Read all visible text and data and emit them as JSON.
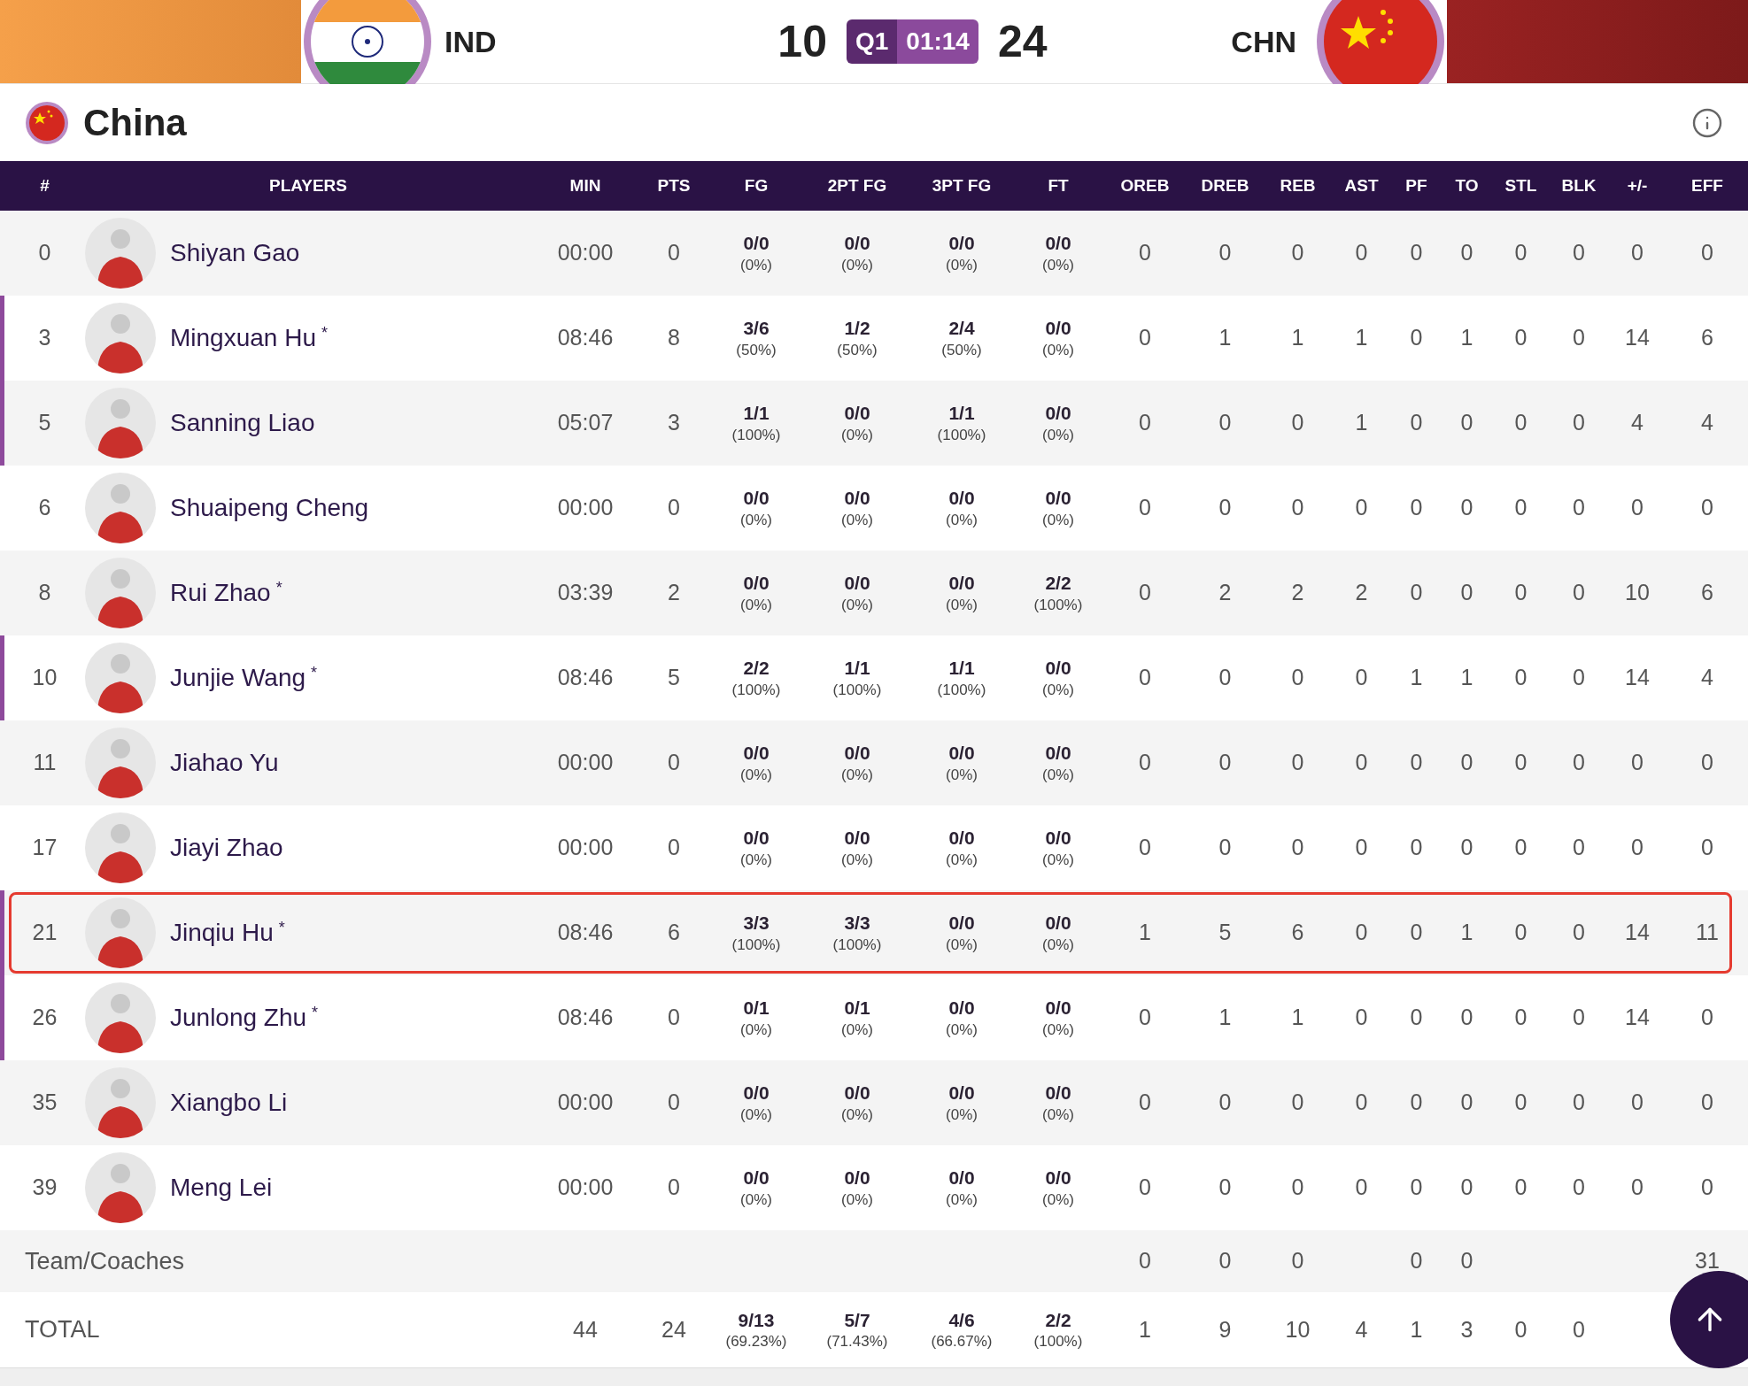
{
  "scoreboard": {
    "home": {
      "code": "IND"
    },
    "away": {
      "code": "CHN"
    },
    "home_score": "10",
    "away_score": "24",
    "period": "Q1",
    "clock": "01:14"
  },
  "team": {
    "name": "China"
  },
  "columns": [
    {
      "label": "#"
    },
    {
      "label": "PLAYERS"
    },
    {
      "label": "MIN"
    },
    {
      "label": "PTS"
    },
    {
      "label": "FG"
    },
    {
      "label": "2PT FG"
    },
    {
      "label": "3PT FG"
    },
    {
      "label": "FT"
    },
    {
      "label": "OREB"
    },
    {
      "label": "DREB"
    },
    {
      "label": "REB"
    },
    {
      "label": "AST"
    },
    {
      "label": "PF"
    },
    {
      "label": "TO"
    },
    {
      "label": "STL"
    },
    {
      "label": "BLK"
    },
    {
      "label": "+/-"
    },
    {
      "label": "EFF"
    }
  ],
  "rows": [
    {
      "number": "0",
      "name": "Shiyan Gao",
      "on_court": false,
      "highlighted": false,
      "min": "00:00",
      "pts": "0",
      "shooting": [
        {
          "made": "0/0",
          "pct": "(0%)"
        },
        {
          "made": "0/0",
          "pct": "(0%)"
        },
        {
          "made": "0/0",
          "pct": "(0%)"
        },
        {
          "made": "0/0",
          "pct": "(0%)"
        }
      ],
      "counts": [
        "0",
        "0",
        "0",
        "0",
        "0",
        "0",
        "0",
        "0",
        "0",
        "0"
      ]
    },
    {
      "number": "3",
      "name": "Mingxuan Hu",
      "marker": "*",
      "on_court": true,
      "highlighted": false,
      "min": "08:46",
      "pts": "8",
      "shooting": [
        {
          "made": "3/6",
          "pct": "(50%)"
        },
        {
          "made": "1/2",
          "pct": "(50%)"
        },
        {
          "made": "2/4",
          "pct": "(50%)"
        },
        {
          "made": "0/0",
          "pct": "(0%)"
        }
      ],
      "counts": [
        "0",
        "1",
        "1",
        "1",
        "0",
        "1",
        "0",
        "0",
        "14",
        "6"
      ]
    },
    {
      "number": "5",
      "name": "Sanning Liao",
      "on_court": true,
      "highlighted": false,
      "min": "05:07",
      "pts": "3",
      "shooting": [
        {
          "made": "1/1",
          "pct": "(100%)"
        },
        {
          "made": "0/0",
          "pct": "(0%)"
        },
        {
          "made": "1/1",
          "pct": "(100%)"
        },
        {
          "made": "0/0",
          "pct": "(0%)"
        }
      ],
      "counts": [
        "0",
        "0",
        "0",
        "1",
        "0",
        "0",
        "0",
        "0",
        "4",
        "4"
      ]
    },
    {
      "number": "6",
      "name": "Shuaipeng Cheng",
      "on_court": false,
      "highlighted": false,
      "min": "00:00",
      "pts": "0",
      "shooting": [
        {
          "made": "0/0",
          "pct": "(0%)"
        },
        {
          "made": "0/0",
          "pct": "(0%)"
        },
        {
          "made": "0/0",
          "pct": "(0%)"
        },
        {
          "made": "0/0",
          "pct": "(0%)"
        }
      ],
      "counts": [
        "0",
        "0",
        "0",
        "0",
        "0",
        "0",
        "0",
        "0",
        "0",
        "0"
      ]
    },
    {
      "number": "8",
      "name": "Rui Zhao",
      "marker": "*",
      "on_court": false,
      "highlighted": false,
      "min": "03:39",
      "pts": "2",
      "shooting": [
        {
          "made": "0/0",
          "pct": "(0%)"
        },
        {
          "made": "0/0",
          "pct": "(0%)"
        },
        {
          "made": "0/0",
          "pct": "(0%)"
        },
        {
          "made": "2/2",
          "pct": "(100%)"
        }
      ],
      "counts": [
        "0",
        "2",
        "2",
        "2",
        "0",
        "0",
        "0",
        "0",
        "10",
        "6"
      ]
    },
    {
      "number": "10",
      "name": "Junjie Wang",
      "marker": "*",
      "on_court": true,
      "highlighted": false,
      "min": "08:46",
      "pts": "5",
      "shooting": [
        {
          "made": "2/2",
          "pct": "(100%)"
        },
        {
          "made": "1/1",
          "pct": "(100%)"
        },
        {
          "made": "1/1",
          "pct": "(100%)"
        },
        {
          "made": "0/0",
          "pct": "(0%)"
        }
      ],
      "counts": [
        "0",
        "0",
        "0",
        "0",
        "1",
        "1",
        "0",
        "0",
        "14",
        "4"
      ]
    },
    {
      "number": "11",
      "name": "Jiahao Yu",
      "on_court": false,
      "highlighted": false,
      "min": "00:00",
      "pts": "0",
      "shooting": [
        {
          "made": "0/0",
          "pct": "(0%)"
        },
        {
          "made": "0/0",
          "pct": "(0%)"
        },
        {
          "made": "0/0",
          "pct": "(0%)"
        },
        {
          "made": "0/0",
          "pct": "(0%)"
        }
      ],
      "counts": [
        "0",
        "0",
        "0",
        "0",
        "0",
        "0",
        "0",
        "0",
        "0",
        "0"
      ]
    },
    {
      "number": "17",
      "name": "Jiayi Zhao",
      "on_court": false,
      "highlighted": false,
      "min": "00:00",
      "pts": "0",
      "shooting": [
        {
          "made": "0/0",
          "pct": "(0%)"
        },
        {
          "made": "0/0",
          "pct": "(0%)"
        },
        {
          "made": "0/0",
          "pct": "(0%)"
        },
        {
          "made": "0/0",
          "pct": "(0%)"
        }
      ],
      "counts": [
        "0",
        "0",
        "0",
        "0",
        "0",
        "0",
        "0",
        "0",
        "0",
        "0"
      ]
    },
    {
      "number": "21",
      "name": "Jinqiu Hu",
      "marker": "*",
      "on_court": true,
      "highlighted": true,
      "min": "08:46",
      "pts": "6",
      "shooting": [
        {
          "made": "3/3",
          "pct": "(100%)"
        },
        {
          "made": "3/3",
          "pct": "(100%)"
        },
        {
          "made": "0/0",
          "pct": "(0%)"
        },
        {
          "made": "0/0",
          "pct": "(0%)"
        }
      ],
      "counts": [
        "1",
        "5",
        "6",
        "0",
        "0",
        "1",
        "0",
        "0",
        "14",
        "11"
      ]
    },
    {
      "number": "26",
      "name": "Junlong Zhu",
      "marker": "*",
      "on_court": true,
      "highlighted": false,
      "min": "08:46",
      "pts": "0",
      "shooting": [
        {
          "made": "0/1",
          "pct": "(0%)"
        },
        {
          "made": "0/1",
          "pct": "(0%)"
        },
        {
          "made": "0/0",
          "pct": "(0%)"
        },
        {
          "made": "0/0",
          "pct": "(0%)"
        }
      ],
      "counts": [
        "0",
        "1",
        "1",
        "0",
        "0",
        "0",
        "0",
        "0",
        "14",
        "0"
      ]
    },
    {
      "number": "35",
      "name": "Xiangbo Li",
      "on_court": false,
      "highlighted": false,
      "min": "00:00",
      "pts": "0",
      "shooting": [
        {
          "made": "0/0",
          "pct": "(0%)"
        },
        {
          "made": "0/0",
          "pct": "(0%)"
        },
        {
          "made": "0/0",
          "pct": "(0%)"
        },
        {
          "made": "0/0",
          "pct": "(0%)"
        }
      ],
      "counts": [
        "0",
        "0",
        "0",
        "0",
        "0",
        "0",
        "0",
        "0",
        "0",
        "0"
      ]
    },
    {
      "number": "39",
      "name": "Meng Lei",
      "on_court": false,
      "highlighted": false,
      "min": "00:00",
      "pts": "0",
      "shooting": [
        {
          "made": "0/0",
          "pct": "(0%)"
        },
        {
          "made": "0/0",
          "pct": "(0%)"
        },
        {
          "made": "0/0",
          "pct": "(0%)"
        },
        {
          "made": "0/0",
          "pct": "(0%)"
        }
      ],
      "counts": [
        "0",
        "0",
        "0",
        "0",
        "0",
        "0",
        "0",
        "0",
        "0",
        "0"
      ]
    }
  ],
  "team_row": {
    "label": "Team/Coaches",
    "counts": {
      "oreb": "0",
      "dreb": "0",
      "reb": "0",
      "pf": "0",
      "to": "0",
      "eff": "31"
    }
  },
  "total_row": {
    "label": "TOTAL",
    "min": "44",
    "pts": "24",
    "shooting": [
      {
        "made": "9/13",
        "pct": "(69.23%)"
      },
      {
        "made": "5/7",
        "pct": "(71.43%)"
      },
      {
        "made": "4/6",
        "pct": "(66.67%)"
      },
      {
        "made": "2/2",
        "pct": "(100%)"
      }
    ],
    "counts": [
      "1",
      "9",
      "10",
      "4",
      "1",
      "3",
      "0",
      "0"
    ]
  }
}
